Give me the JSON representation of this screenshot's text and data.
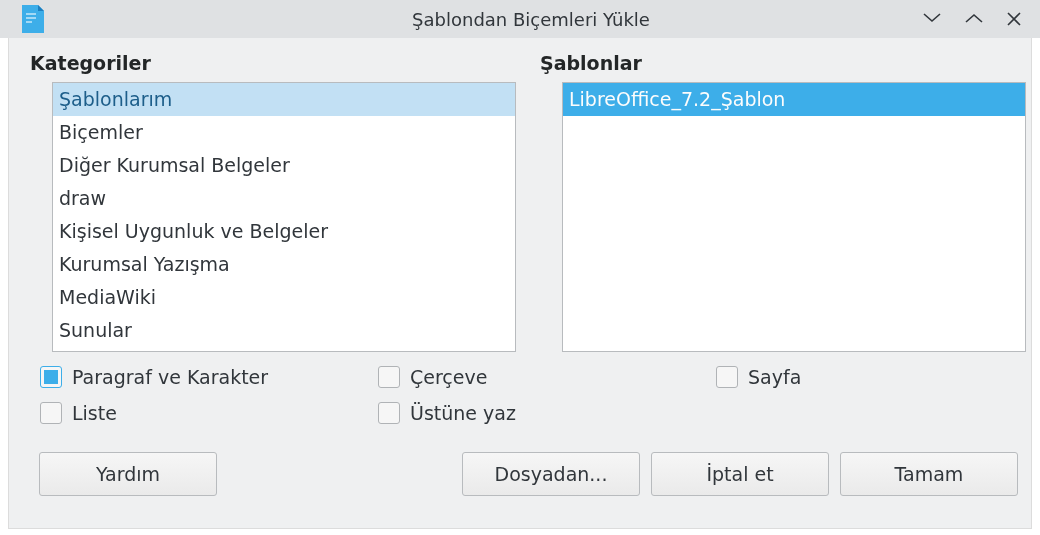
{
  "window": {
    "title": "Şablondan Biçemleri Yükle"
  },
  "categories": {
    "label": "Kategoriler",
    "focused": false,
    "items": [
      {
        "label": "Şablonlarım",
        "selected": true
      },
      {
        "label": "Biçemler",
        "selected": false
      },
      {
        "label": "Diğer Kurumsal Belgeler",
        "selected": false
      },
      {
        "label": "draw",
        "selected": false
      },
      {
        "label": "Kişisel Uygunluk ve Belgeler",
        "selected": false
      },
      {
        "label": "Kurumsal Yazışma",
        "selected": false
      },
      {
        "label": "MediaWiki",
        "selected": false
      },
      {
        "label": "Sunular",
        "selected": false
      }
    ]
  },
  "templates": {
    "label": "Şablonlar",
    "focused": true,
    "items": [
      {
        "label": "LibreOffice_7.2_Şablon",
        "selected": true
      }
    ]
  },
  "options": [
    {
      "label": "Paragraf ve Karakter",
      "checked": true
    },
    {
      "label": "Çerçeve",
      "checked": false
    },
    {
      "label": "Sayfa",
      "checked": false
    },
    {
      "label": "Liste",
      "checked": false
    },
    {
      "label": "Üstüne yaz",
      "checked": false
    }
  ],
  "buttons": {
    "help": "Yardım",
    "actions": [
      "Dosyadan...",
      "İptal et",
      "Tamam"
    ]
  }
}
